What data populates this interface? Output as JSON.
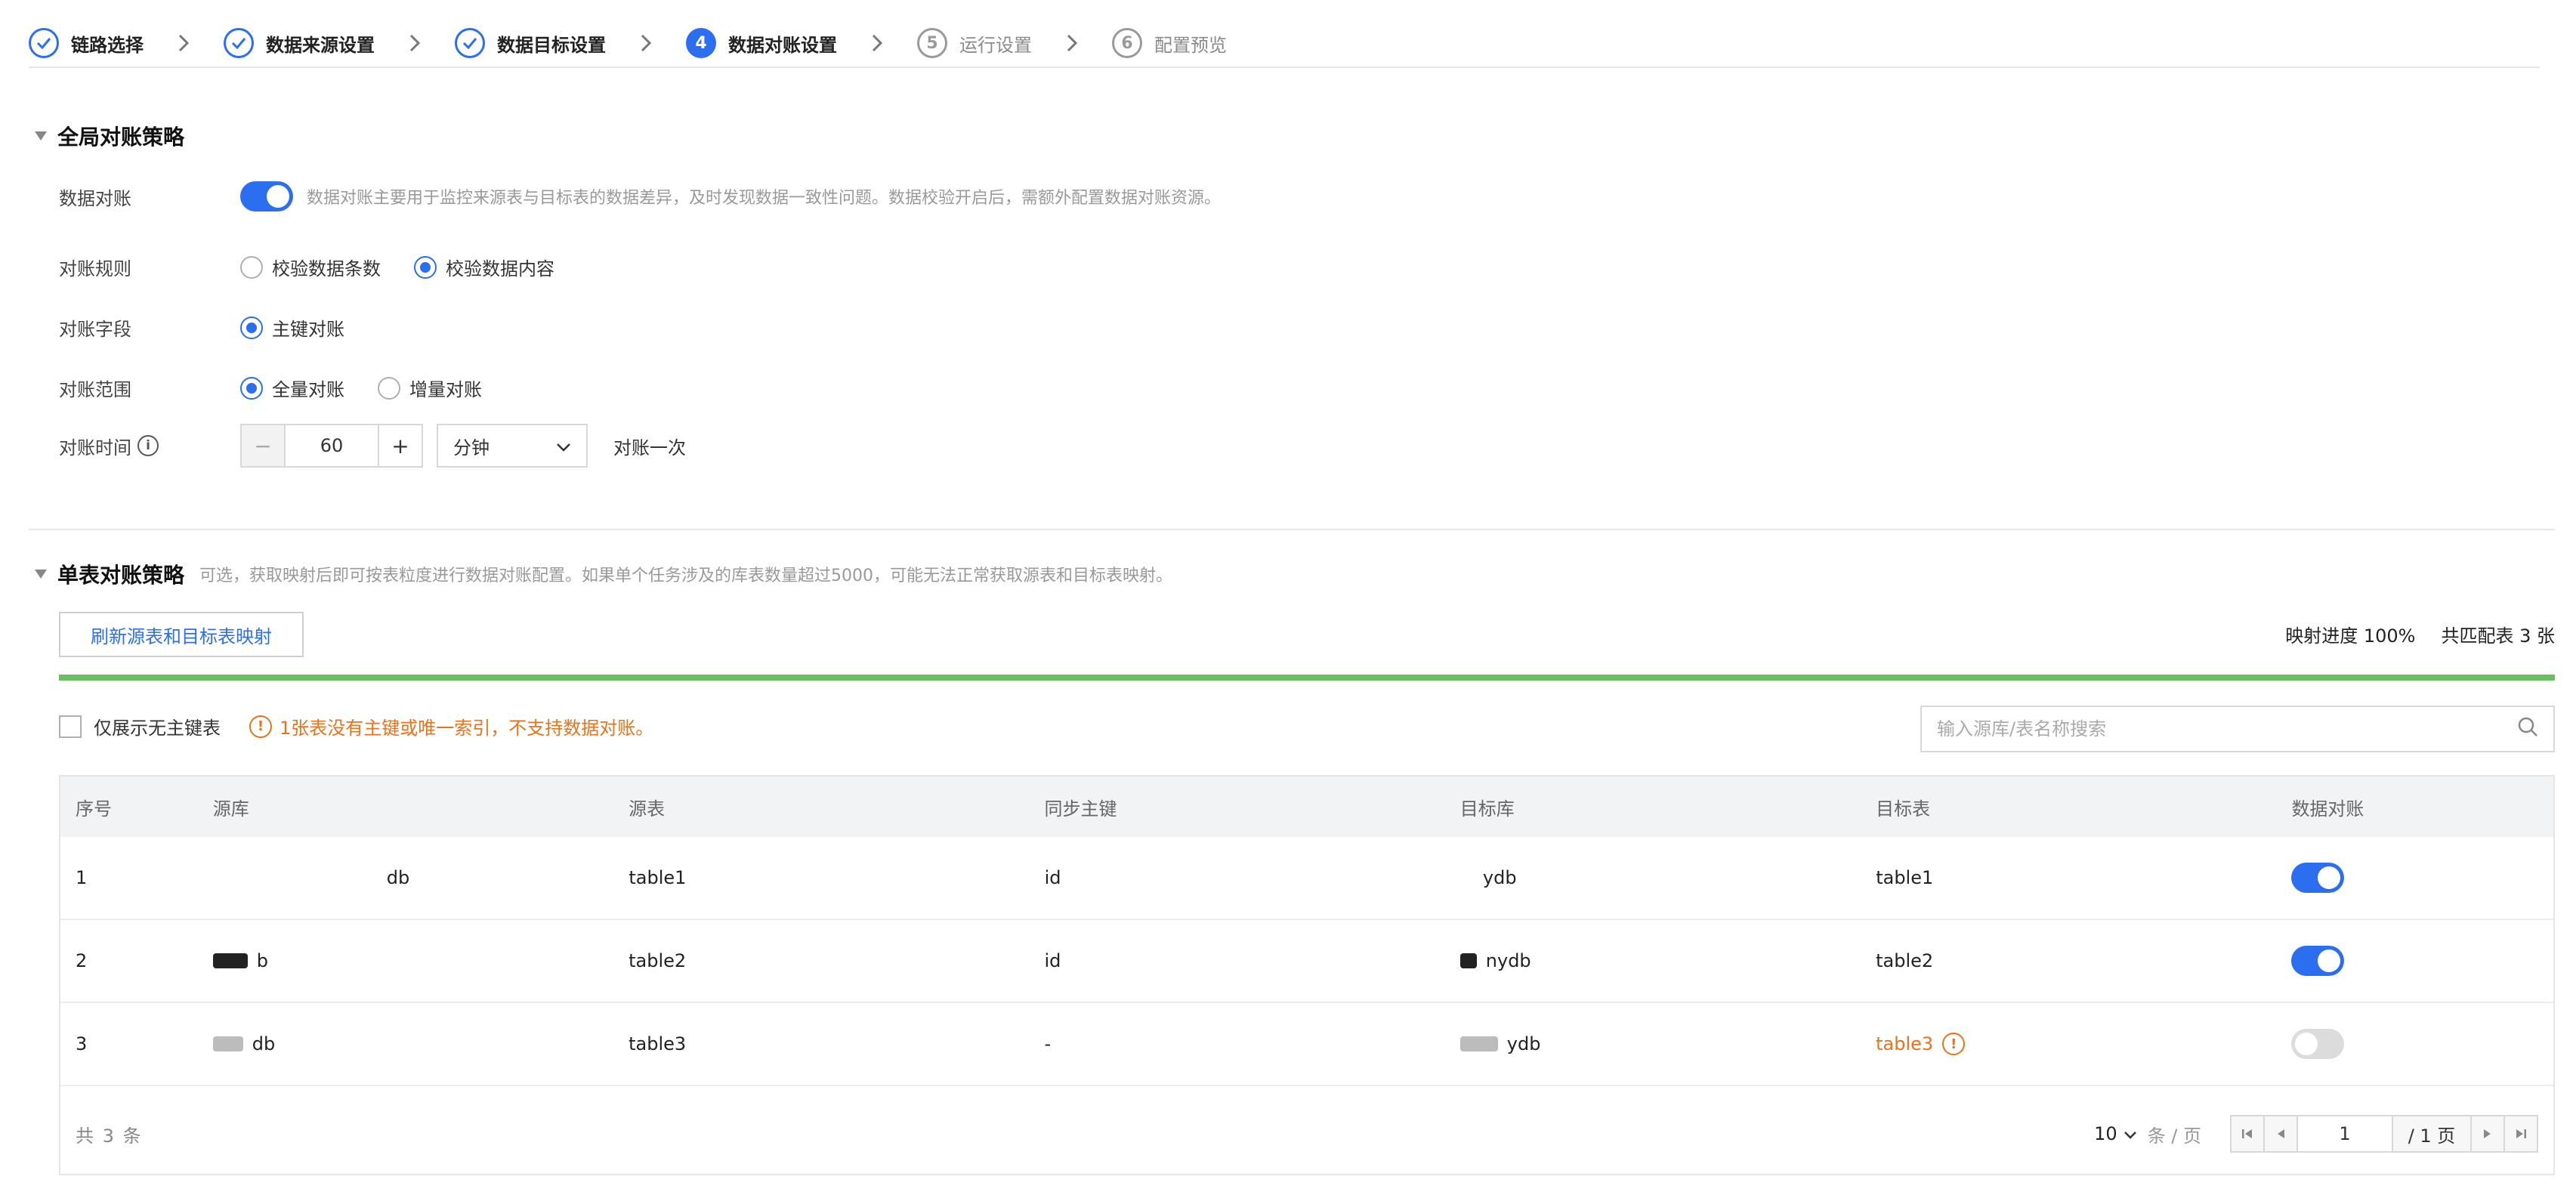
{
  "steps": [
    {
      "label": "链路选择",
      "status": "done"
    },
    {
      "label": "数据来源设置",
      "status": "done"
    },
    {
      "label": "数据目标设置",
      "status": "done"
    },
    {
      "label": "数据对账设置",
      "status": "current",
      "number": "4"
    },
    {
      "label": "运行设置",
      "status": "todo",
      "number": "5"
    },
    {
      "label": "配置预览",
      "status": "todo",
      "number": "6"
    }
  ],
  "global": {
    "title": "全局对账策略",
    "reconcile_label": "数据对账",
    "reconcile_hint": "数据对账主要用于监控来源表与目标表的数据差异，及时发现数据一致性问题。数据校验开启后，需额外配置数据对账资源。",
    "reconcile_enabled": true,
    "rule_label": "对账规则",
    "rule_options": [
      "校验数据条数",
      "校验数据内容"
    ],
    "rule_selected": "校验数据内容",
    "field_label": "对账字段",
    "field_options": [
      "主键对账"
    ],
    "field_selected": "主键对账",
    "scope_label": "对账范围",
    "scope_options": [
      "全量对账",
      "增量对账"
    ],
    "scope_selected": "全量对账",
    "time_label": "对账时间",
    "time_value": "60",
    "time_unit": "分钟",
    "time_suffix": "对账一次"
  },
  "single": {
    "title": "单表对账策略",
    "desc": "可选，获取映射后即可按表粒度进行数据对账配置。如果单个任务涉及的库表数量超过5000，可能无法正常获取源表和目标表映射。",
    "refresh_button": "刷新源表和目标表映射",
    "progress_text": "映射进度 100%",
    "progress_fraction": 1.0,
    "matched_text": "共匹配表 3 张",
    "only_no_pk_label": "仅展示无主键表",
    "warning": "1张表没有主键或唯一索引，不支持数据对账。",
    "search_placeholder": "输入源库/表名称搜索"
  },
  "table": {
    "columns": [
      "序号",
      "源库",
      "源表",
      "同步主键",
      "目标库",
      "目标表",
      "数据对账"
    ],
    "rows": [
      {
        "index": "1",
        "source_db": "db",
        "source_table": "table1",
        "pk": "id",
        "target_db": "ydb",
        "target_table": "table1",
        "enabled": true,
        "warn": false
      },
      {
        "index": "2",
        "source_db": "b",
        "source_table": "table2",
        "pk": "id",
        "target_db": "nydb",
        "target_table": "table2",
        "enabled": true,
        "warn": false
      },
      {
        "index": "3",
        "source_db": "db",
        "source_table": "table3",
        "pk": "-",
        "target_db": "ydb",
        "target_table": "table3",
        "enabled": false,
        "warn": true
      }
    ],
    "total_text": "共 3 条",
    "page_size": "10",
    "per_page_text": "条 / 页",
    "current_page": "1",
    "total_pages_text": "/ 1 页"
  },
  "colors": {
    "accent": "#2b6ff0",
    "warning": "#e8731a",
    "progress": "#6bbd62"
  }
}
